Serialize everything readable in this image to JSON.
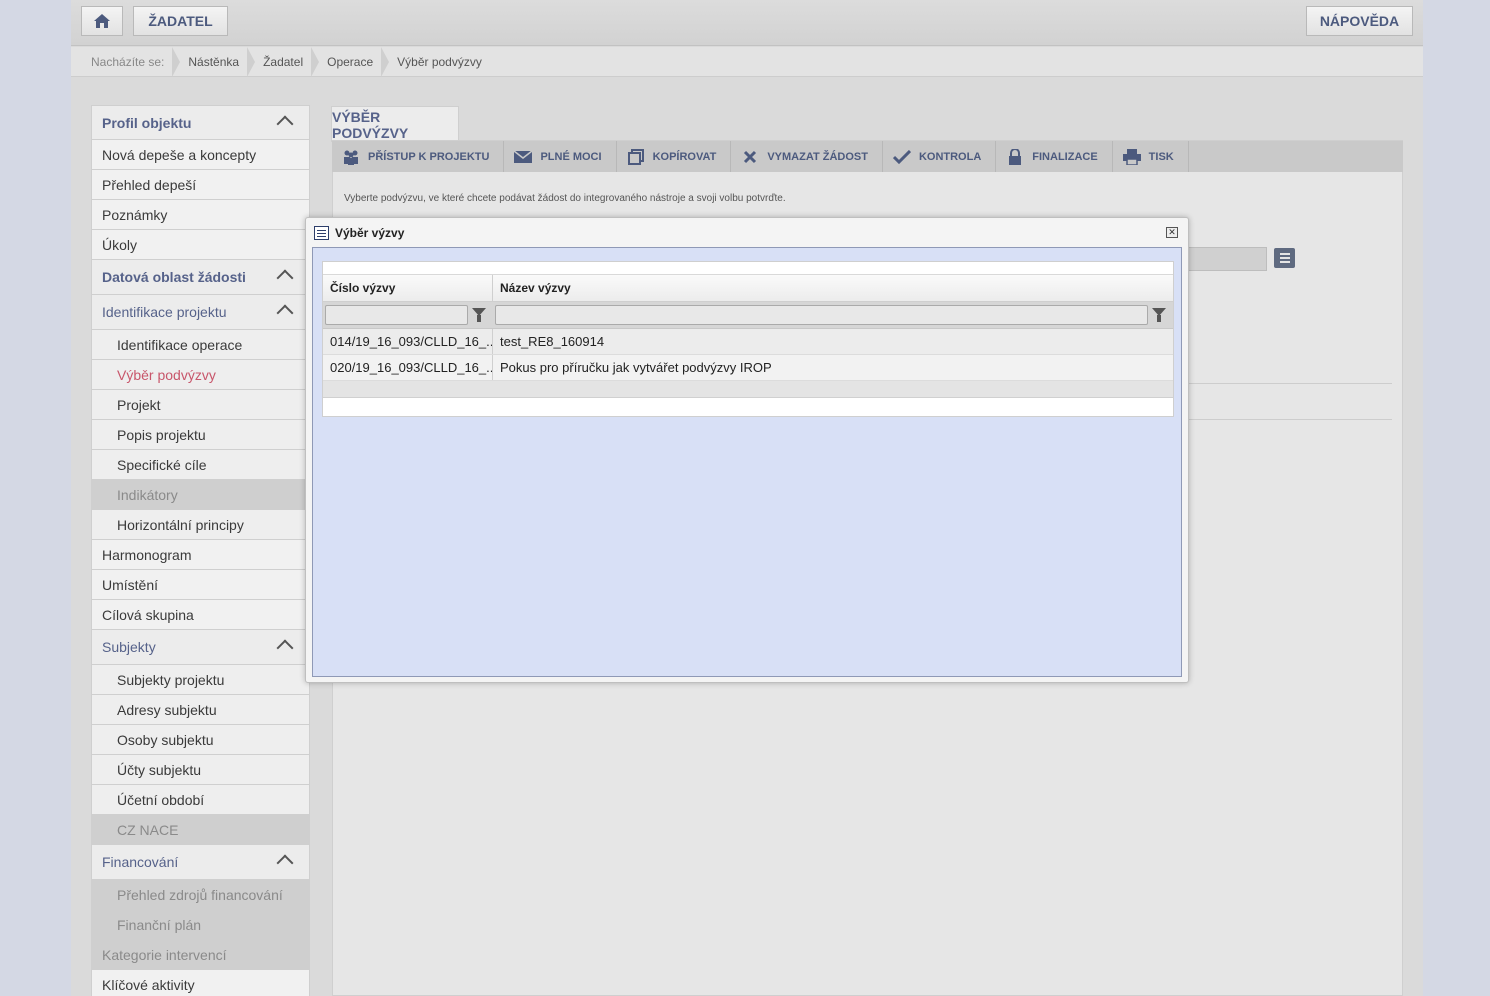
{
  "header": {
    "zadatel_label": "ŽADATEL",
    "help_label": "NÁPOVĚDA"
  },
  "breadcrumb": {
    "label": "Nacházíte se:",
    "items": [
      "Nástěnka",
      "Žadatel",
      "Operace",
      "Výběr podvýzvy"
    ]
  },
  "sidebar": {
    "items": [
      {
        "label": "Profil objektu"
      },
      {
        "label": "Nová depeše a koncepty"
      },
      {
        "label": "Přehled depeší"
      },
      {
        "label": "Poznámky"
      },
      {
        "label": "Úkoly"
      },
      {
        "label": "Datová oblast žádosti"
      },
      {
        "label": "Identifikace projektu"
      },
      {
        "label": "Identifikace operace"
      },
      {
        "label": "Výběr podvýzvy"
      },
      {
        "label": "Projekt"
      },
      {
        "label": "Popis projektu"
      },
      {
        "label": "Specifické cíle"
      },
      {
        "label": "Indikátory"
      },
      {
        "label": "Horizontální principy"
      },
      {
        "label": "Harmonogram"
      },
      {
        "label": "Umístění"
      },
      {
        "label": "Cílová skupina"
      },
      {
        "label": "Subjekty"
      },
      {
        "label": "Subjekty projektu"
      },
      {
        "label": "Adresy subjektu"
      },
      {
        "label": "Osoby subjektu"
      },
      {
        "label": "Účty subjektu"
      },
      {
        "label": "Účetní období"
      },
      {
        "label": "CZ NACE"
      },
      {
        "label": "Financování"
      },
      {
        "label": "Přehled zdrojů financování"
      },
      {
        "label": "Finanční plán"
      },
      {
        "label": "Kategorie intervencí"
      },
      {
        "label": "Klíčové aktivity"
      }
    ]
  },
  "main": {
    "tab_title": "VÝBĚR PODVÝZVY",
    "toolbar": [
      {
        "label": "PŘÍSTUP K PROJEKTU",
        "icon": "people-icon"
      },
      {
        "label": "PLNÉ MOCI",
        "icon": "envelope-icon"
      },
      {
        "label": "KOPÍROVAT",
        "icon": "copy-icon"
      },
      {
        "label": "VYMAZAT ŽÁDOST",
        "icon": "delete-icon"
      },
      {
        "label": "KONTROLA",
        "icon": "check-icon"
      },
      {
        "label": "FINALIZACE",
        "icon": "lock-icon"
      },
      {
        "label": "TISK",
        "icon": "printer-icon"
      }
    ],
    "intro": "Vyberte podvýzvu, ve které chcete podávat žádost do integrovaného nástroje a svoji volbu potvrďte."
  },
  "dialog": {
    "title": "Výběr výzvy",
    "columns": [
      "Číslo výzvy",
      "Název výzvy"
    ],
    "rows": [
      {
        "cislo": "014/19_16_093/CLLD_16_...",
        "nazev": "test_RE8_160914"
      },
      {
        "cislo": "020/19_16_093/CLLD_16_...",
        "nazev": "Pokus pro příručku jak vytvářet podvýzvy IROP"
      }
    ]
  }
}
